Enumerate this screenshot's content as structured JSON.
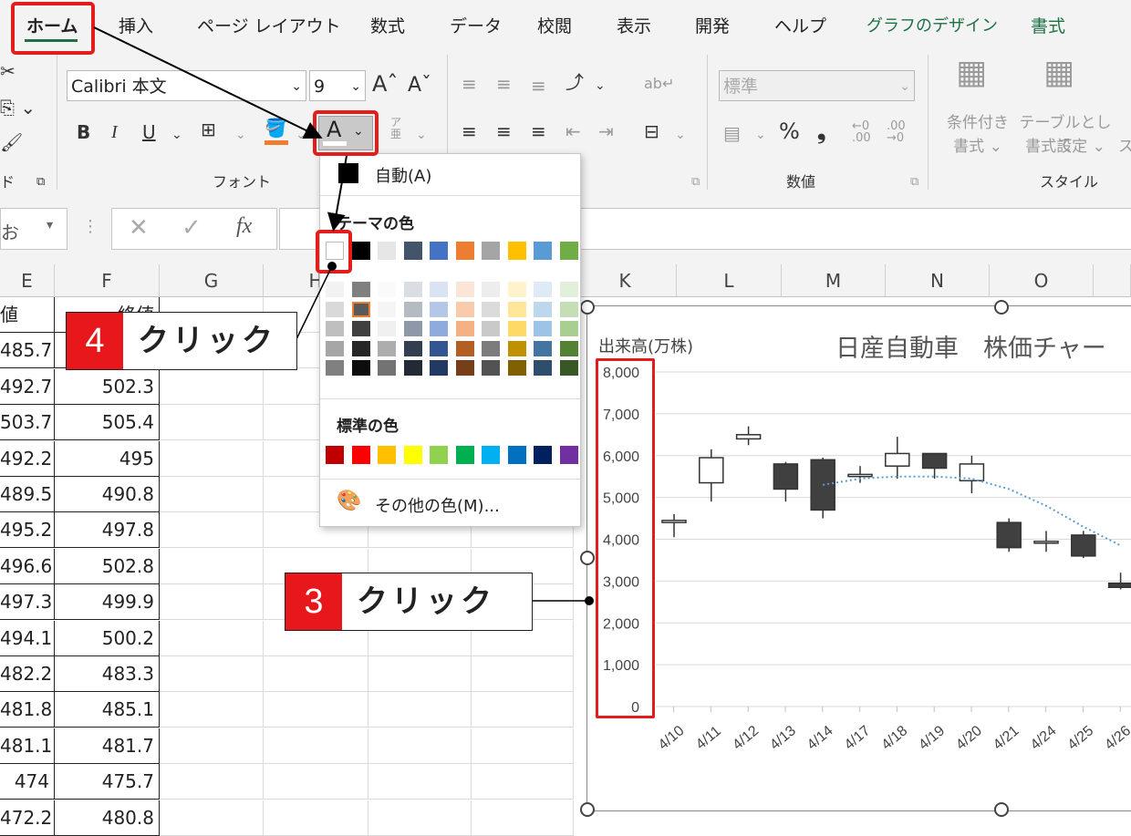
{
  "ribbon": {
    "tabs": [
      "ホーム",
      "挿入",
      "ページ レイアウト",
      "数式",
      "データ",
      "校閲",
      "表示",
      "開発",
      "ヘルプ",
      "グラフのデザイン",
      "書式"
    ],
    "font_name": "Calibri 本文",
    "font_size": "9",
    "number_format": "標準",
    "group_labels": {
      "clipboard": "ド",
      "font": "フォント",
      "number": "数値",
      "style": "スタイル"
    },
    "style_btn1_line1": "条件付き",
    "style_btn1_line2": "書式 ⌄",
    "style_btn2_line1": "テーブルとして",
    "style_btn2_line2": "書式設定 ⌄",
    "style_btn3": "ス"
  },
  "formula_bar": {
    "name_box": "お"
  },
  "grid": {
    "col_headers": [
      "E",
      "F",
      "G",
      "H",
      "K",
      "L",
      "M",
      "N",
      "O"
    ],
    "e_header": "値",
    "f_header": "終値",
    "e_values": [
      "485.7",
      "492.7",
      "503.7",
      "492.2",
      "489.5",
      "495.2",
      "496.6",
      "497.3",
      "494.1",
      "482.2",
      "481.8",
      "481.1",
      "474",
      "472.2"
    ],
    "f_values": [
      "",
      "502.3",
      "505.4",
      "495",
      "490.8",
      "497.8",
      "502.8",
      "499.9",
      "500.2",
      "483.3",
      "485.1",
      "481.7",
      "475.7",
      "480.8"
    ]
  },
  "menu": {
    "auto": "自動(A)",
    "theme_title": "テーマの色",
    "standard_title": "標準の色",
    "more_colors": "その他の色(M)...",
    "theme_colors": [
      "#ffffff",
      "#000000",
      "#e7e6e6",
      "#44546a",
      "#4472c4",
      "#ed7d31",
      "#a5a5a5",
      "#ffc000",
      "#5b9bd5",
      "#70ad47"
    ],
    "standard_colors": [
      "#c00000",
      "#ff0000",
      "#ffc000",
      "#ffff00",
      "#92d050",
      "#00b050",
      "#00b0f0",
      "#0070c0",
      "#002060",
      "#7030a0"
    ]
  },
  "callouts": {
    "c4_num": "4",
    "c4_text": "クリック",
    "c3_num": "3",
    "c3_text": "クリック"
  },
  "chart_data": {
    "type": "candlestick",
    "title": "日産自動車　株価チャー",
    "ylabel": "出来高(万株)",
    "y_ticks": [
      "8,000",
      "7,000",
      "6,000",
      "5,000",
      "4,000",
      "3,000",
      "2,000",
      "1,000",
      "0"
    ],
    "ylim": [
      0,
      8000
    ],
    "categories": [
      "4/10",
      "4/11",
      "4/12",
      "4/13",
      "4/14",
      "4/17",
      "4/18",
      "4/19",
      "4/20",
      "4/21",
      "4/24",
      "4/25",
      "4/26"
    ],
    "candles": [
      {
        "open": 4400,
        "close": 4450,
        "high": 4600,
        "low": 4050
      },
      {
        "open": 5350,
        "close": 5950,
        "high": 6150,
        "low": 4900
      },
      {
        "open": 6400,
        "close": 6500,
        "high": 6700,
        "low": 6250
      },
      {
        "open": 5800,
        "close": 5200,
        "high": 5850,
        "low": 4900
      },
      {
        "open": 5900,
        "close": 4700,
        "high": 5950,
        "low": 4500
      },
      {
        "open": 5500,
        "close": 5550,
        "high": 5750,
        "low": 5350
      },
      {
        "open": 5750,
        "close": 6050,
        "high": 6450,
        "low": 5450
      },
      {
        "open": 6050,
        "close": 5700,
        "high": 6050,
        "low": 5450
      },
      {
        "open": 5400,
        "close": 5800,
        "high": 6000,
        "low": 5100
      },
      {
        "open": 4400,
        "close": 3800,
        "high": 4500,
        "low": 3700
      },
      {
        "open": 3950,
        "close": 3950,
        "high": 4200,
        "low": 3700
      },
      {
        "open": 4100,
        "close": 3600,
        "high": 4200,
        "low": 3550
      },
      {
        "open": 2950,
        "close": 2850,
        "high": 3200,
        "low": 2800
      }
    ],
    "trend": [
      null,
      null,
      null,
      null,
      5300,
      5450,
      5500,
      5500,
      5450,
      5200,
      4800,
      4300,
      3850
    ]
  }
}
